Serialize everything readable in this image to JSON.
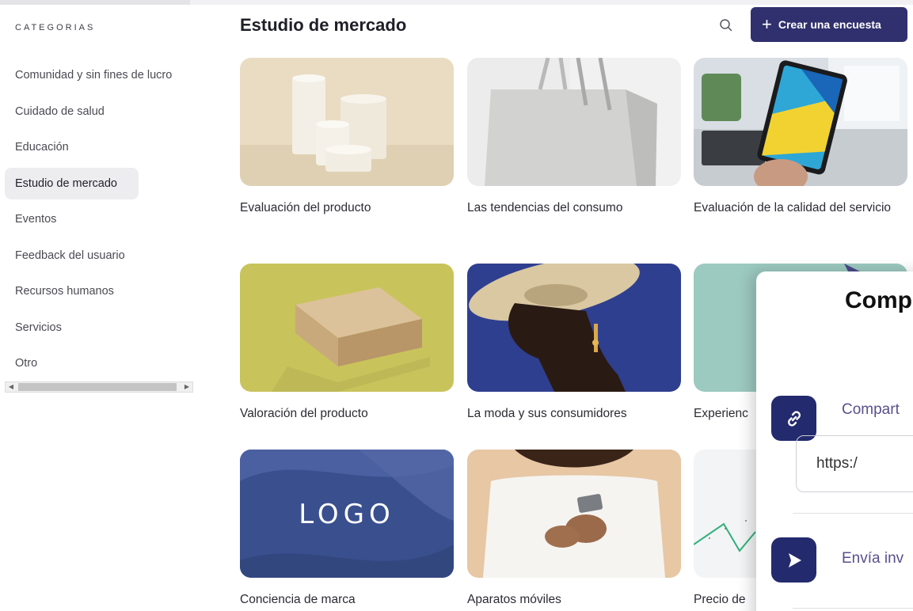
{
  "sidebar": {
    "heading": "CATEGORIAS",
    "items": [
      {
        "label": "Comunidad y sin fines de lucro",
        "active": false
      },
      {
        "label": "Cuidado de salud",
        "active": false
      },
      {
        "label": "Educación",
        "active": false
      },
      {
        "label": "Estudio de mercado",
        "active": true
      },
      {
        "label": "Eventos",
        "active": false
      },
      {
        "label": "Feedback del usuario",
        "active": false
      },
      {
        "label": "Recursos humanos",
        "active": false
      },
      {
        "label": "Servicios",
        "active": false
      },
      {
        "label": "Otro",
        "active": false
      }
    ]
  },
  "header": {
    "title": "Estudio de mercado",
    "search_icon": "search-icon",
    "create_label": "Crear una encuesta",
    "create_icon": "plus-icon"
  },
  "templates": [
    {
      "title": "Evaluación del producto",
      "image": "white-cylinders-photo"
    },
    {
      "title": "Las tendencias del consumo",
      "image": "shopping-bag-photo"
    },
    {
      "title": "Evaluación de la calidad del servicio",
      "image": "tablet-in-hand-photo"
    },
    {
      "title": "Valoración del producto",
      "image": "cardboard-box-photo"
    },
    {
      "title": "La moda y sus consumidores",
      "image": "woman-with-hat-photo"
    },
    {
      "title": "Experienc",
      "image": "teal-abstract-photo"
    },
    {
      "title": "Conciencia de marca",
      "image": "logo-placeholder-photo",
      "logo_text": "LOGO"
    },
    {
      "title": "Aparatos móviles",
      "image": "woman-with-phone-photo"
    },
    {
      "title": "Precio de",
      "image": "price-line-chart-photo"
    }
  ],
  "share_panel": {
    "title": "Comp",
    "link_label": "Compart",
    "link_icon": "link-icon",
    "url_value": "https:/",
    "invite_label": "Envía inv",
    "invite_icon": "send-icon"
  },
  "colors": {
    "accent": "#30306e",
    "share_icon_bg": "#232a6d",
    "active_item_bg": "#ededf0"
  }
}
